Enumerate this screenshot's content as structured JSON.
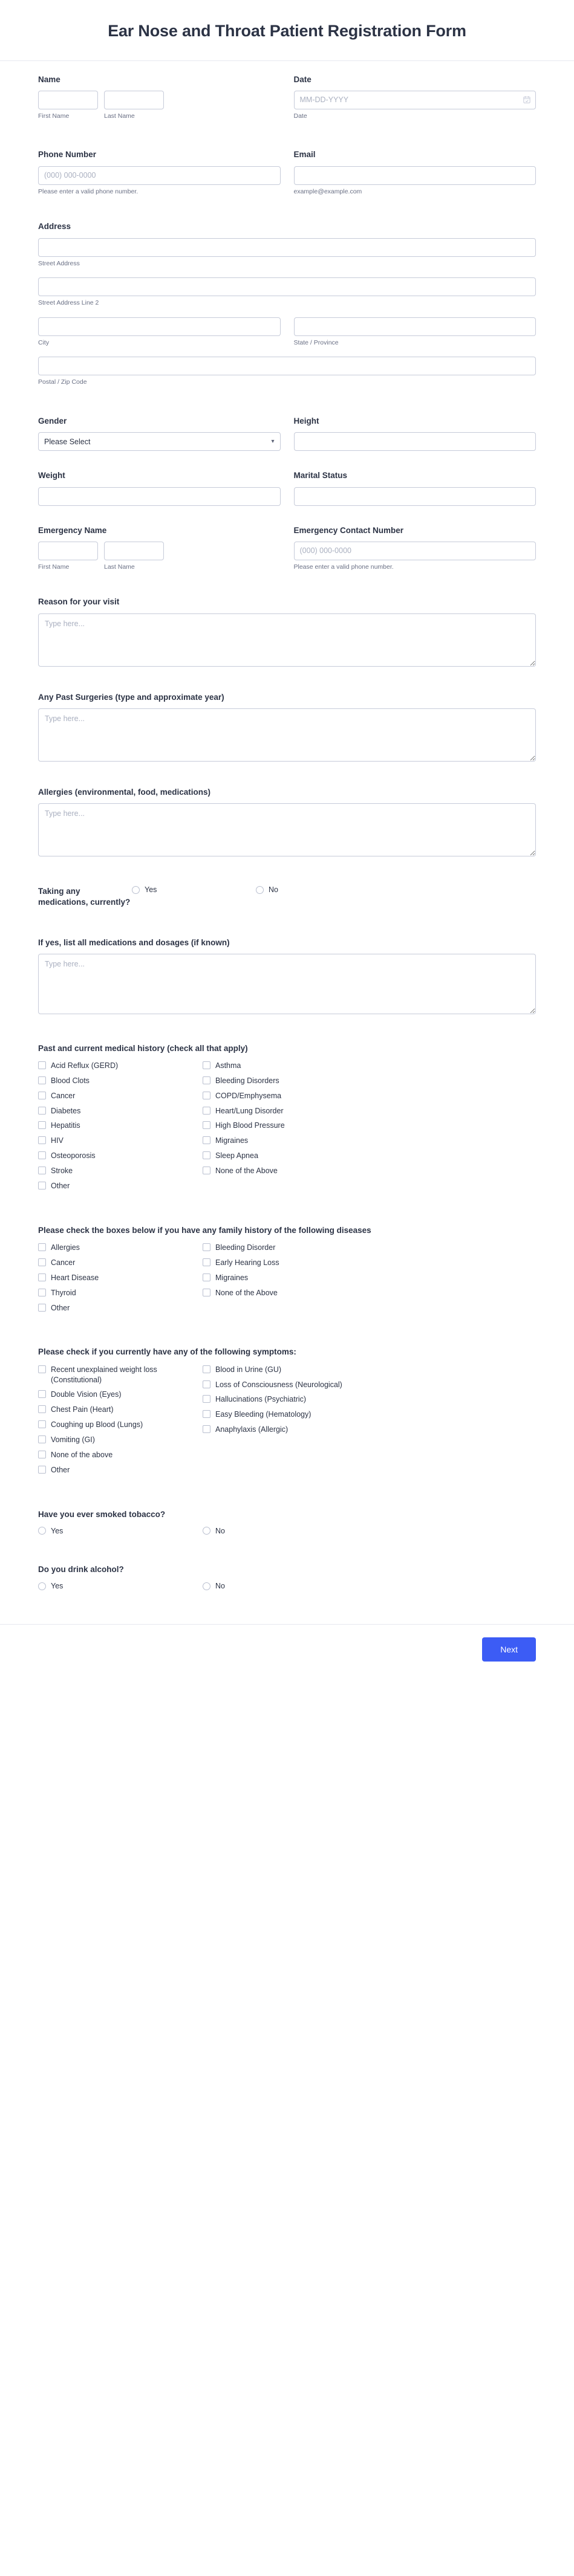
{
  "header": {
    "title": "Ear Nose and Throat Patient Registration Form"
  },
  "name": {
    "label": "Name",
    "first_sub": "First Name",
    "last_sub": "Last Name",
    "first_value": "",
    "last_value": ""
  },
  "date": {
    "label": "Date",
    "placeholder": "MM-DD-YYYY",
    "sub": "Date",
    "value": "",
    "icon": "calendar-icon"
  },
  "phone": {
    "label": "Phone Number",
    "placeholder": "(000) 000-0000",
    "sub": "Please enter a valid phone number.",
    "value": ""
  },
  "email": {
    "label": "Email",
    "sub": "example@example.com",
    "placeholder": "",
    "value": ""
  },
  "address": {
    "label": "Address",
    "street_sub": "Street Address",
    "street2_sub": "Street Address Line 2",
    "city_sub": "City",
    "state_sub": "State / Province",
    "postal_sub": "Postal / Zip Code",
    "street_value": "",
    "street2_value": "",
    "city_value": "",
    "state_value": "",
    "postal_value": ""
  },
  "gender": {
    "label": "Gender",
    "selected": "Please Select",
    "options": [
      "Please Select"
    ],
    "caret_icon": "chevron-down-icon"
  },
  "height": {
    "label": "Height",
    "value": ""
  },
  "weight": {
    "label": "Weight",
    "value": ""
  },
  "marital_status": {
    "label": "Marital Status",
    "value": ""
  },
  "emergency_name": {
    "label": "Emergency Name",
    "first_sub": "First Name",
    "last_sub": "Last Name",
    "first_value": "",
    "last_value": ""
  },
  "emergency_phone": {
    "label": "Emergency Contact Number",
    "placeholder": "(000) 000-0000",
    "sub": "Please enter a valid phone number.",
    "value": ""
  },
  "reason_visit": {
    "label": "Reason for your visit",
    "placeholder": "Type here...",
    "value": ""
  },
  "past_surgeries": {
    "label": "Any Past Surgeries (type and approximate year)",
    "placeholder": "Type here...",
    "value": ""
  },
  "allergies": {
    "label": "Allergies (environmental, food, medications)",
    "placeholder": "Type here...",
    "value": ""
  },
  "medications_question": {
    "label": "Taking any medications, currently?",
    "options": [
      "Yes",
      "No"
    ],
    "selected": ""
  },
  "medications_list": {
    "label": "If yes, list all medications and dosages (if known)",
    "placeholder": "Type here...",
    "value": ""
  },
  "medical_history": {
    "label": "Past and current medical history (check all that apply)",
    "left": [
      "Acid Reflux (GERD)",
      "Blood Clots",
      "Cancer",
      "Diabetes",
      "Hepatitis",
      "HIV",
      "Osteoporosis",
      "Stroke",
      "Other"
    ],
    "right": [
      "Asthma",
      "Bleeding Disorders",
      "COPD/Emphysema",
      "Heart/Lung Disorder",
      "High Blood Pressure",
      "Migraines",
      "Sleep Apnea",
      "None of the Above"
    ]
  },
  "family_history": {
    "label": "Please check the boxes below if you have any family history of the following diseases",
    "left": [
      "Allergies",
      "Cancer",
      "Heart Disease",
      "Thyroid",
      "Other"
    ],
    "right": [
      "Bleeding Disorder",
      "Early Hearing Loss",
      "Migraines",
      "None of the Above"
    ]
  },
  "symptoms": {
    "label": "Please check if you currently have any of the following symptoms:",
    "left": [
      "Recent unexplained weight loss (Constitutional)",
      "Double Vision (Eyes)",
      "Chest Pain (Heart)",
      "Coughing up Blood (Lungs)",
      "Vomiting (GI)",
      "None of the above",
      "Other"
    ],
    "right": [
      "Blood in Urine (GU)",
      "Loss of Consciousness (Neurological)",
      "Hallucinations (Psychiatric)",
      "Easy Bleeding (Hematology)",
      "Anaphylaxis (Allergic)"
    ]
  },
  "tobacco": {
    "label": "Have you ever smoked tobacco?",
    "options": [
      "Yes",
      "No"
    ],
    "selected": ""
  },
  "alcohol": {
    "label": "Do you drink alcohol?",
    "options": [
      "Yes",
      "No"
    ],
    "selected": ""
  },
  "footer": {
    "next_label": "Next",
    "accent_color": "#3c5cf5"
  }
}
